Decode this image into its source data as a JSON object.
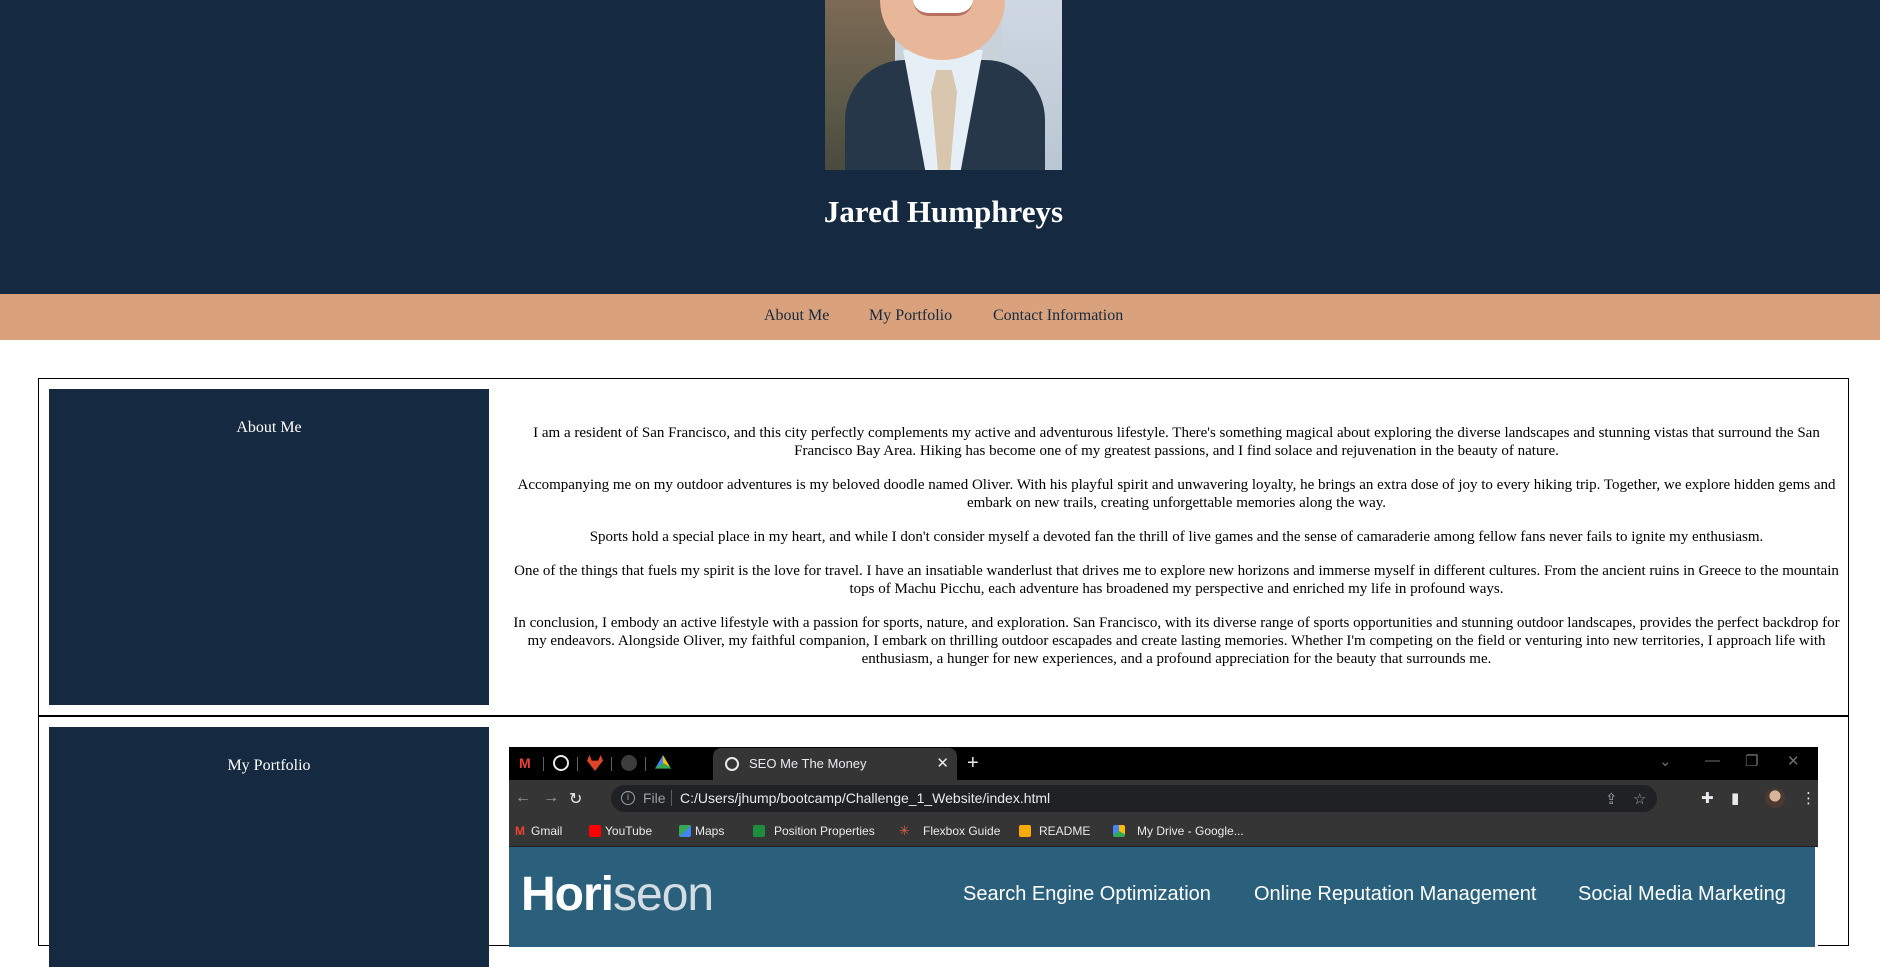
{
  "header": {
    "name": "Jared Humphreys",
    "photo_alt": "Portrait photo"
  },
  "nav": {
    "items": [
      "About Me",
      "My Portfolio",
      "Contact Information"
    ]
  },
  "about": {
    "title": "About Me",
    "paragraphs": [
      "I am a resident of San Francisco, and this city perfectly complements my active and adventurous lifestyle. There's something magical about exploring the diverse landscapes and stunning vistas that surround the San Francisco Bay Area. Hiking has become one of my greatest passions, and I find solace and rejuvenation in the beauty of nature.",
      "Accompanying me on my outdoor adventures is my beloved doodle named Oliver. With his playful spirit and unwavering loyalty, he brings an extra dose of joy to every hiking trip. Together, we explore hidden gems and embark on new trails, creating unforgettable memories along the way.",
      "Sports hold a special place in my heart, and while I don't consider myself a devoted fan the thrill of live games and the sense of camaraderie among fellow fans never fails to ignite my enthusiasm.",
      "One of the things that fuels my spirit is the love for travel. I have an insatiable wanderlust that drives me to explore new horizons and immerse myself in different cultures. From the ancient ruins in Greece to the mountain tops of Machu Picchu, each adventure has broadened my perspective and enriched my life in profound ways.",
      "In conclusion, I embody an active lifestyle with a passion for sports, nature, and exploration. San Francisco, with its diverse range of sports opportunities and stunning outdoor landscapes, provides the perfect backdrop for my endeavors. Alongside Oliver, my faithful companion, I embark on thrilling outdoor escapades and create lasting memories. Whether I'm competing on the field or venturing into new territories, I approach life with enthusiasm, a hunger for new experiences, and a profound appreciation for the beauty that surrounds me."
    ]
  },
  "portfolio": {
    "title": "My Portfolio",
    "screenshot": {
      "tab_title": "SEO Me The Money",
      "file_label": "File",
      "url": "C:/Users/jhump/bootcamp/Challenge_1_Website/index.html",
      "bookmarks": [
        "Gmail",
        "YouTube",
        "Maps",
        "Position Properties",
        "Flexbox Guide",
        "README",
        "My Drive - Google..."
      ],
      "site_logo_a": "Hori",
      "site_logo_b": "seon",
      "site_nav": [
        "Search Engine Optimization",
        "Online Reputation Management",
        "Social Media Marketing"
      ]
    }
  },
  "colors": {
    "header_bg": "#152a40",
    "nav_bg": "#d9a27c",
    "site_bg": "#2a607c"
  }
}
